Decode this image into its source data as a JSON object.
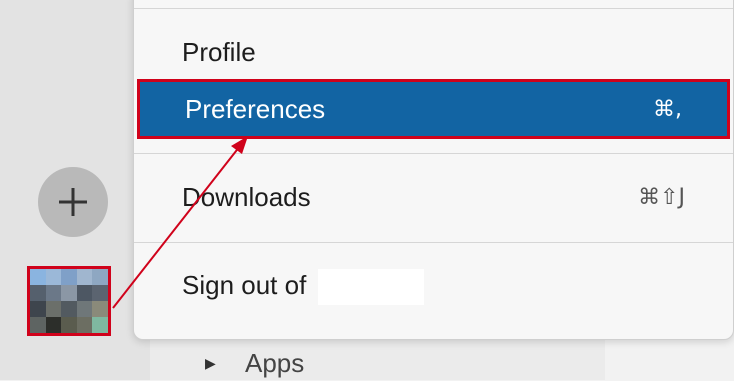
{
  "menu": {
    "profile_label": "Profile",
    "preferences_label": "Preferences",
    "preferences_shortcut": "⌘,",
    "downloads_label": "Downloads",
    "downloads_shortcut": "⌘⇧J",
    "signout_label": "Sign out of"
  },
  "sidebar": {
    "apps_label": "Apps",
    "apps_caret": "▶"
  },
  "colors": {
    "highlight": "#1264a3",
    "annotation": "#d0021b"
  },
  "icons": [
    "plus-icon",
    "caret-right-icon",
    "annotation-arrow"
  ]
}
